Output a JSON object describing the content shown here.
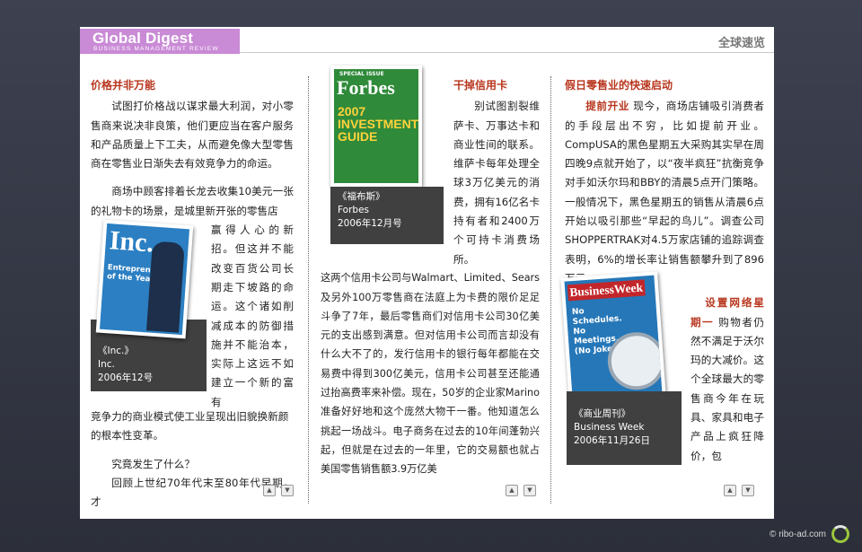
{
  "header": {
    "brand_title": "Global Digest",
    "brand_subtitle": "BUSINESS MANAGEMENT REVIEW",
    "section_title": "全球速览"
  },
  "col1": {
    "heading": "价格并非万能",
    "p1": "试图打价格战以谋求最大利润，对小零售商来说决非良策，他们更应当在客户服务和产品质量上下工夫，从而避免像大型零售商在零售业日渐失去有效竞争力的命运。",
    "p2_start": "商场中顾客排着长龙去收集10美元一张的礼物卡的场景，是城里新开张的零售店",
    "p2_side": "赢得人心的新招。但这并不能改变百货公司长期走下坡路的命运。这个诸如削减成本的防御措施并不能治本，实际上这远不如建立一个新的富有",
    "p2_end": "竞争力的商业模式使工业呈现出旧貌换新颜的根本性变革。",
    "p3": "究竟发生了什么？",
    "p4": "回顾上世纪70年代末至80年代早期，才",
    "caption": [
      "《Inc.》",
      "Inc.",
      "2006年12号"
    ],
    "cover": {
      "logo": "Inc.",
      "headline": "Entrepreneur of the Year",
      "bg": "#2b7fc2"
    }
  },
  "col2": {
    "heading": "干掉信用卡",
    "side_text": "别试图割裂维萨卡、万事达卡和商业性间的联系。维萨卡每年处理全球3万亿美元的消费，拥有16亿名卡持有者和2400万个可持卡消费场所。",
    "body": "这两个信用卡公司与Walmart、Limited、Sears及另外100万零售商在法庭上为卡费的限价足足斗争了7年，最后零售商们对信用卡公司30亿美元的支出感到满意。但对信用卡公司而言却没有什么大不了的，发行信用卡的银行每年都能在交易费中得到300亿美元，信用卡公司甚至还能通过抬高费率来补偿。现在，50岁的企业家Marino准备好好地和这个庞然大物干一番。他知道怎么挑起一场战斗。电子商务在过去的10年间蓬勃兴起，但就是在过去的一年里，它的交易额也就占美国零售销售额3.9万亿美",
    "caption": [
      "《福布斯》",
      "Forbes",
      "2006年12月号"
    ],
    "cover": {
      "badge": "SPECIAL ISSUE",
      "logo": "Forbes",
      "headline": "2007 INVESTMENT GUIDE",
      "bg": "#2f8a3a"
    }
  },
  "col3": {
    "heading": "假日零售业的快速启动",
    "lead": "提前开业",
    "p1": "现今，商场店铺吸引消费者的手段层出不穷，比如提前开业。CompUSA的黑色星期五大采购其实早在周四晚9点就开始了，以“夜半疯狂”抗衡竞争对手如沃尔玛和BBY的清晨5点开门策略。一般情况下，黑色星期五的销售从清晨6点开始以吸引那些“早起的鸟儿”。调查公司SHOPPERTRAK对4.5万家店铺的追踪调查表明，6%的增长率让销售额攀升到了896万元。",
    "lead2": "设置网络星期一",
    "p2": "购物者仍然不满足于沃尔玛的大减价。这个全球最大的零售商今年在玩具、家具和电子产品上疯狂降价，包",
    "caption": [
      "《商业周刊》",
      "Business Week",
      "2006年11月26日"
    ],
    "cover": {
      "logo": "BusinessWeek",
      "headline": "No Schedules. No Meetings. (No Joke.)",
      "bg": "#2577b8"
    }
  },
  "footer": {
    "copyright": "© ribo-ad.com"
  }
}
